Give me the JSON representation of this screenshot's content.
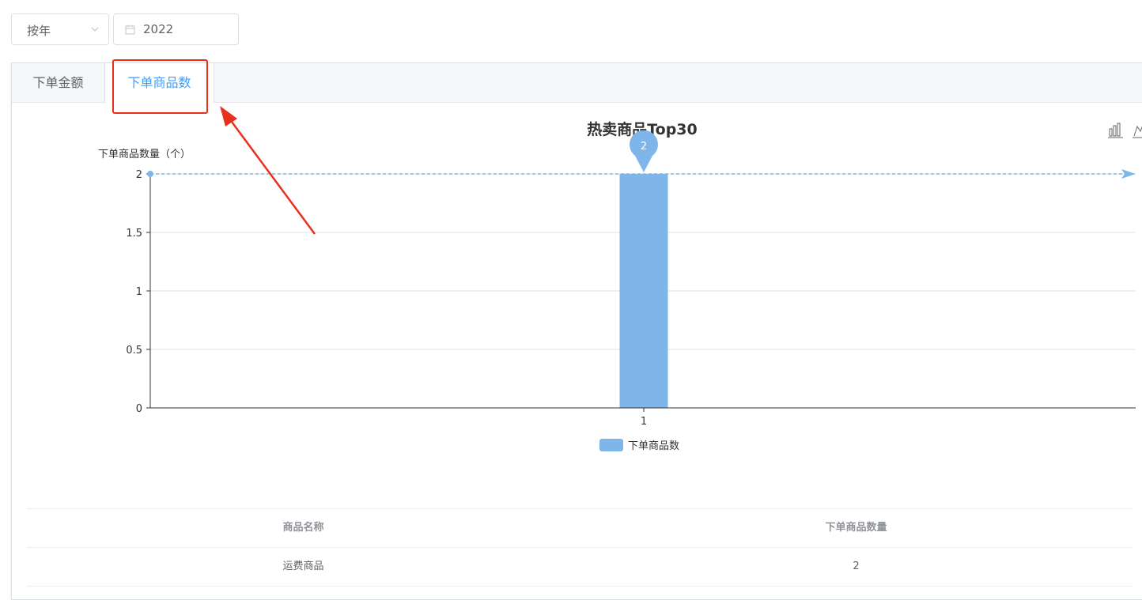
{
  "filters": {
    "period_select": "按年",
    "year_value": "2022"
  },
  "tabs": [
    {
      "label": "下单金额",
      "active": false
    },
    {
      "label": "下单商品数",
      "active": true
    }
  ],
  "colors": {
    "bar": "#7eb6ea",
    "accent": "#409eff",
    "annotation": "#e8301e"
  },
  "icons": [
    "chevron-down-icon",
    "calendar-icon",
    "bar-chart-toggle-icon",
    "line-chart-toggle-icon"
  ],
  "chart_data": {
    "type": "bar",
    "title": "热卖商品Top30",
    "ylabel": "下单商品数量（个）",
    "xlabel": "",
    "categories": [
      "1"
    ],
    "series": [
      {
        "name": "下单商品数",
        "values": [
          2
        ]
      }
    ],
    "ylim": [
      0,
      2
    ],
    "yticks": [
      "0",
      "0.5",
      "1",
      "1.5",
      "2"
    ],
    "mark_point": {
      "label": "2",
      "value": 2
    },
    "mark_line": {
      "value": 2
    },
    "grid": true,
    "legend": "bottom-center"
  },
  "table": {
    "headers": [
      "商品名称",
      "下单商品数量"
    ],
    "rows": [
      [
        "运费商品",
        "2"
      ]
    ]
  }
}
